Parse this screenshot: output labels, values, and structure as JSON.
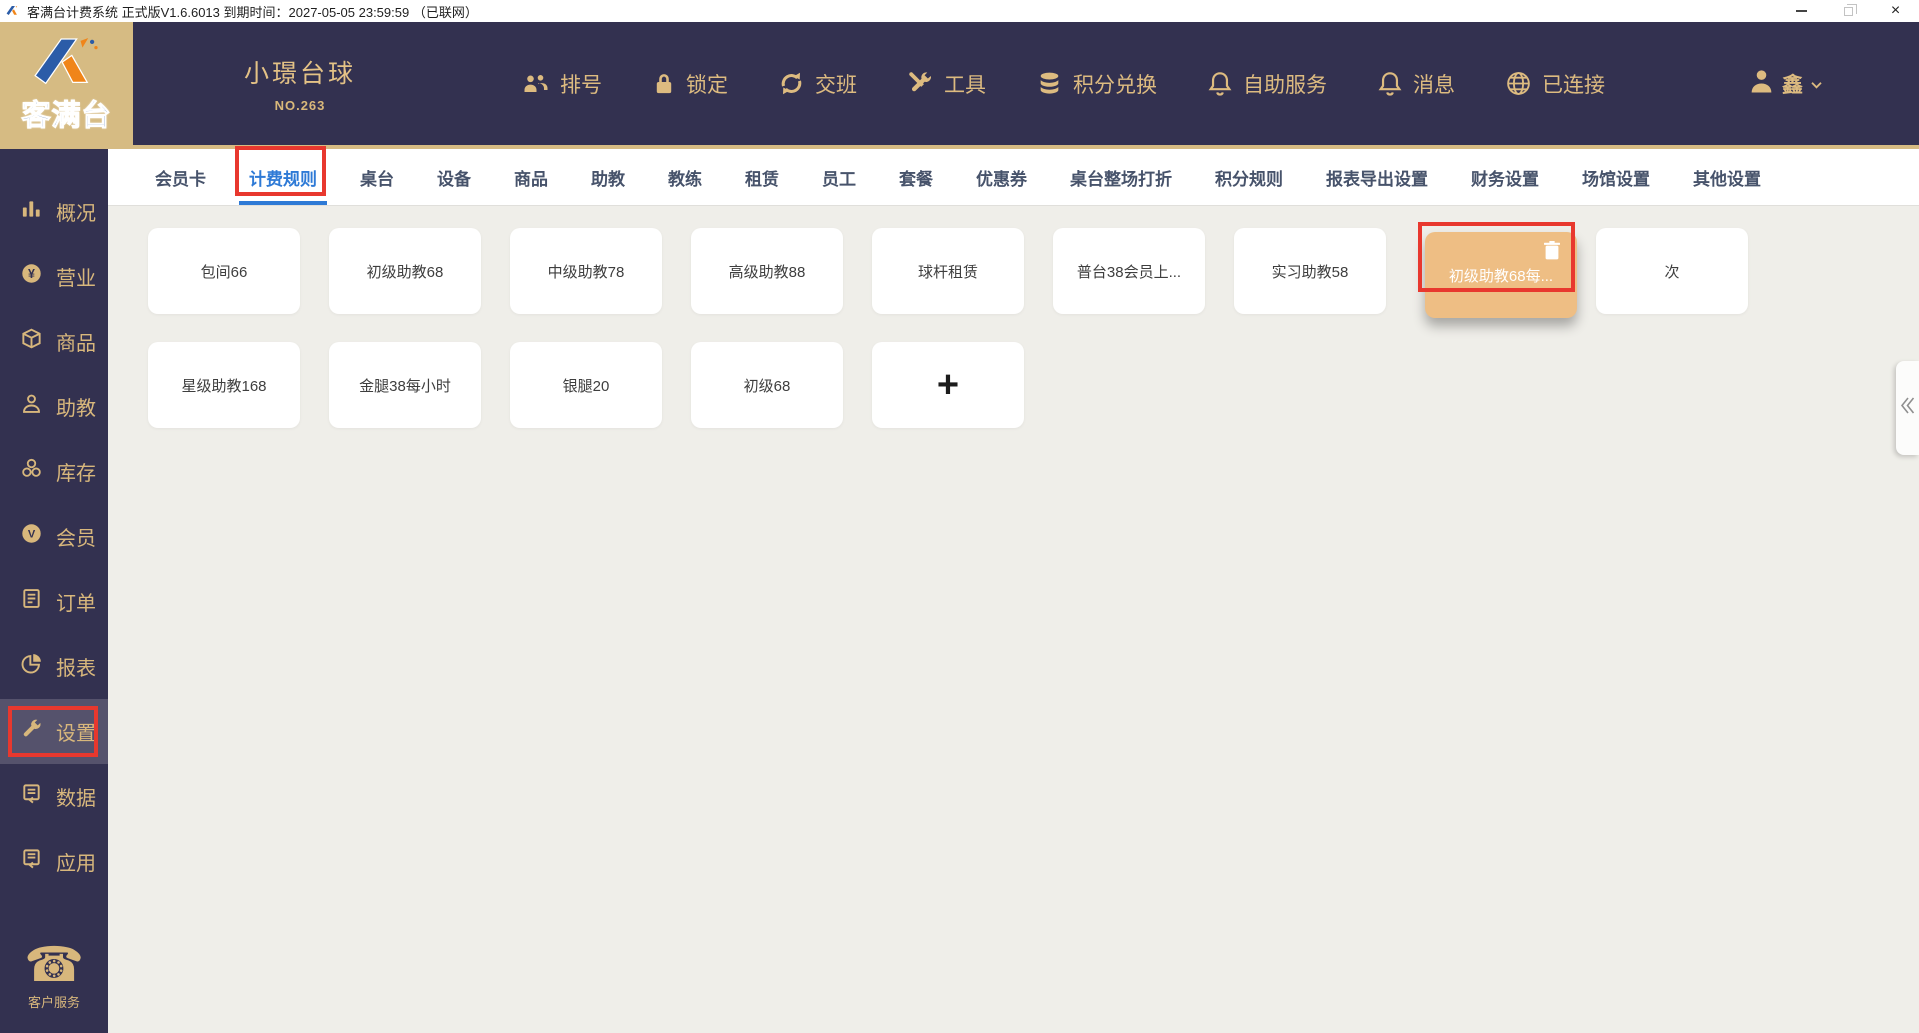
{
  "titlebar": {
    "title": "客满台计费系统 正式版V1.6.6013 到期时间：2027-05-05 23:59:59 （已联网）"
  },
  "header": {
    "venue_name": "小璟台球",
    "venue_no": "NO.263",
    "buttons": [
      {
        "id": "queue",
        "label": "排号",
        "icon": "people-icon"
      },
      {
        "id": "lock",
        "label": "锁定",
        "icon": "lock-icon"
      },
      {
        "id": "shift-change",
        "label": "交班",
        "icon": "shift-change-icon"
      },
      {
        "id": "tools",
        "label": "工具",
        "icon": "tools-icon"
      },
      {
        "id": "points-exchange",
        "label": "积分兑换",
        "icon": "coins-icon"
      },
      {
        "id": "self-service",
        "label": "自助服务",
        "icon": "bell-icon"
      },
      {
        "id": "messages",
        "label": "消息",
        "icon": "bell-icon"
      },
      {
        "id": "connected",
        "label": "已连接",
        "icon": "globe-icon"
      }
    ],
    "user_name": "鑫"
  },
  "sidebar": {
    "items": [
      {
        "label": "概况",
        "icon": "bar-chart-icon",
        "active": false
      },
      {
        "label": "营业",
        "icon": "yen-coin-icon",
        "active": false
      },
      {
        "label": "商品",
        "icon": "box-icon",
        "active": false
      },
      {
        "label": "助教",
        "icon": "person-icon",
        "active": false
      },
      {
        "label": "库存",
        "icon": "stock-icon",
        "active": false
      },
      {
        "label": "会员",
        "icon": "v-badge-icon",
        "active": false
      },
      {
        "label": "订单",
        "icon": "order-list-icon",
        "active": false
      },
      {
        "label": "报表",
        "icon": "pie-chart-icon",
        "active": false
      },
      {
        "label": "设置",
        "icon": "wrench-icon",
        "active": true
      },
      {
        "label": "数据",
        "icon": "data-doc-icon",
        "active": false
      },
      {
        "label": "应用",
        "icon": "app-doc-icon",
        "active": false
      }
    ],
    "footer_label": "客户服务"
  },
  "tabs": {
    "active_index": 1,
    "items": [
      "会员卡",
      "计费规则",
      "桌台",
      "设备",
      "商品",
      "助教",
      "教练",
      "租赁",
      "员工",
      "套餐",
      "优惠券",
      "桌台整场打折",
      "积分规则",
      "报表导出设置",
      "财务设置",
      "场馆设置",
      "其他设置"
    ]
  },
  "cards": {
    "row1": [
      {
        "label": "包间66"
      },
      {
        "label": "初级助教68"
      },
      {
        "label": "中级助教78"
      },
      {
        "label": "高级助教88"
      },
      {
        "label": "球杆租赁"
      },
      {
        "label": "普台38会员上..."
      },
      {
        "label": "实习助教58"
      },
      {
        "label": "初级助教68每...",
        "highlighted": true,
        "icon": "trash-icon"
      },
      {
        "label": "次"
      }
    ],
    "row2": [
      {
        "label": "星级助教168"
      },
      {
        "label": "金腿38每小时"
      },
      {
        "label": "银腿20"
      },
      {
        "label": "初级68"
      }
    ],
    "add_label": "+"
  },
  "colors": {
    "navy": "#333150",
    "gold_block": "#d6bb83",
    "gold_text": "#ddbb80",
    "annotation_red": "#e8382e",
    "active_tab_blue": "#2e7ad6",
    "highlight_card_orange": "#eebe84",
    "content_bg": "#efeee9"
  },
  "icons": [
    "app-logo-k-icon",
    "people-icon",
    "lock-icon",
    "shift-change-icon",
    "tools-icon",
    "coins-icon",
    "bell-icon",
    "globe-icon",
    "avatar-icon",
    "chevron-down-icon",
    "bar-chart-icon",
    "yen-coin-icon",
    "box-icon",
    "person-icon",
    "stock-icon",
    "v-badge-icon",
    "order-list-icon",
    "pie-chart-icon",
    "wrench-icon",
    "data-doc-icon",
    "app-doc-icon",
    "phone-icon",
    "trash-icon",
    "double-chevron-left-icon",
    "minimize-icon",
    "restore-icon",
    "close-icon"
  ]
}
